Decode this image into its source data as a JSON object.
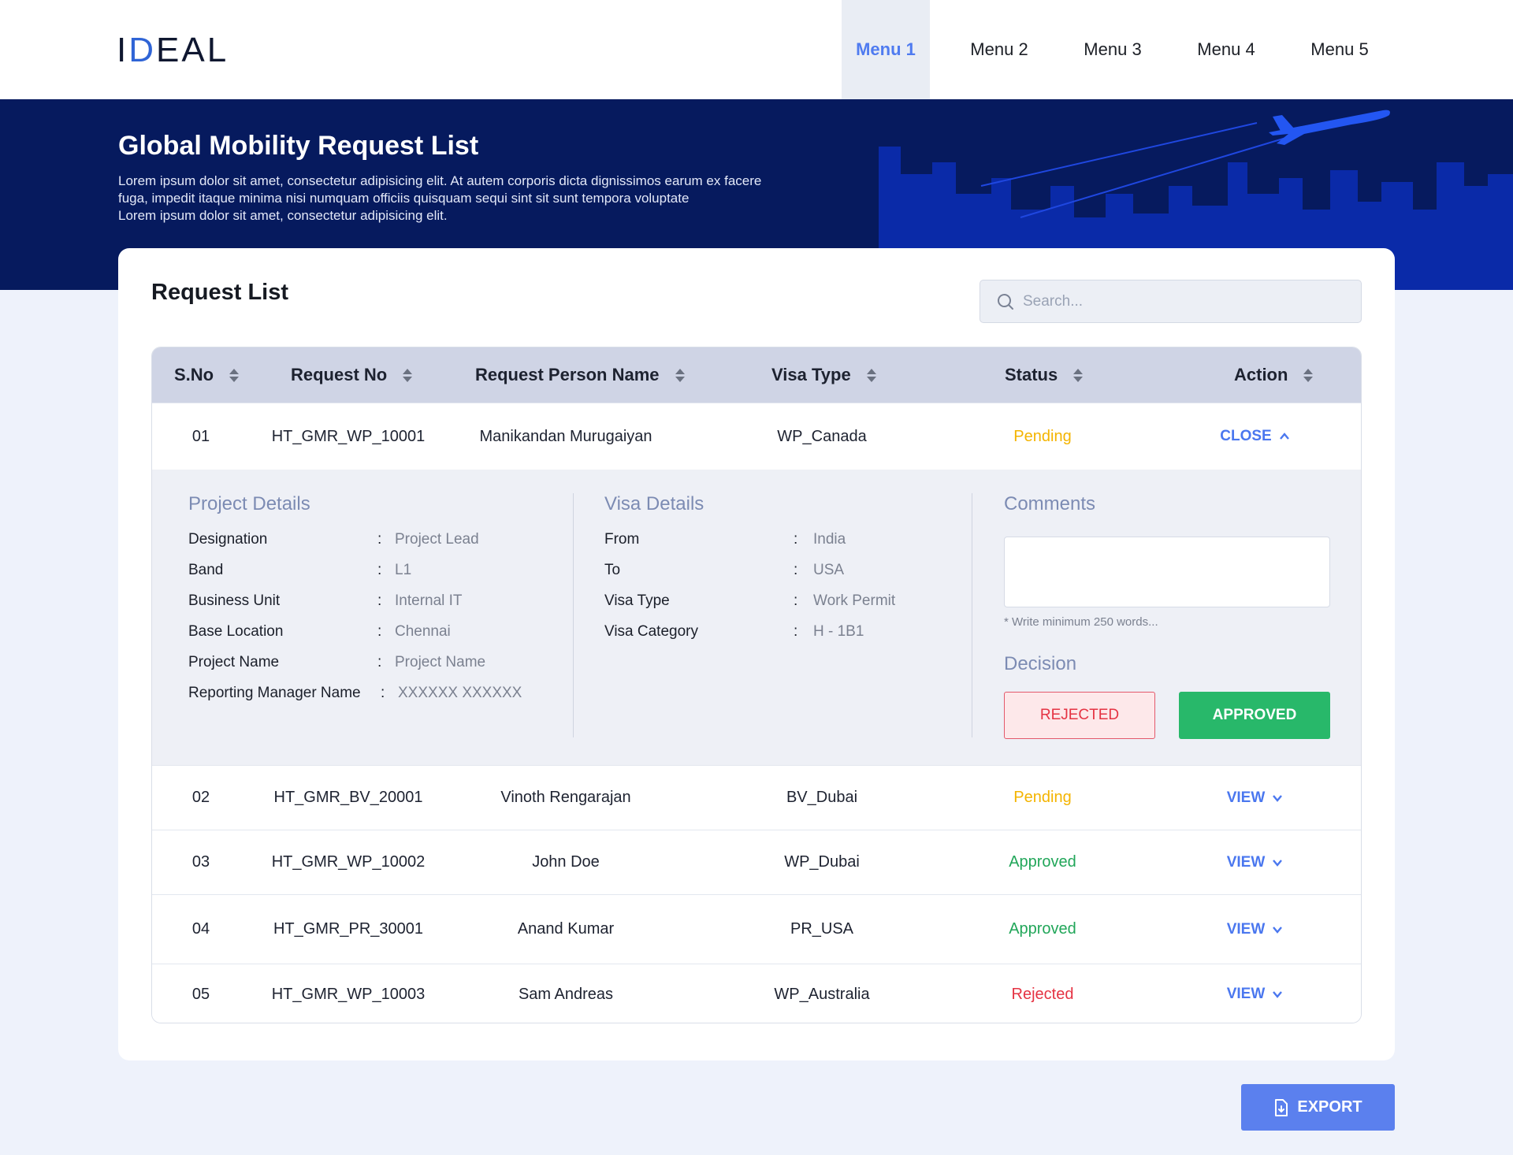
{
  "header": {
    "logo_text_1": "I",
    "logo_text_2": "D",
    "logo_text_3": "E",
    "logo_text_4": "A",
    "logo_text_5": "L",
    "nav": [
      {
        "label": "Menu 1"
      },
      {
        "label": "Menu 2"
      },
      {
        "label": "Menu 3"
      },
      {
        "label": "Menu 4"
      },
      {
        "label": "Menu 5"
      }
    ]
  },
  "banner": {
    "title": "Global Mobility Request List",
    "desc_1": "Lorem ipsum dolor sit amet, consectetur adipisicing elit. At autem corporis dicta dignissimos earum ex facere",
    "desc_2": "fuga, impedit itaque minima nisi numquam officiis quisquam sequi sint sit sunt tempora voluptate",
    "desc_3": "Lorem ipsum dolor sit amet, consectetur adipisicing elit."
  },
  "card": {
    "title": "Request List",
    "search_placeholder": "Search..."
  },
  "table": {
    "columns": [
      "S.No",
      "Request No",
      "Request Person Name",
      "Visa Type",
      "Status",
      "Action"
    ],
    "rows": [
      {
        "sno": "01",
        "request_no": "HT_GMR_WP_10001",
        "name": "Manikandan Murugaiyan",
        "visa_type": "WP_Canada",
        "status": "Pending",
        "action": "CLOSE"
      },
      {
        "sno": "02",
        "request_no": "HT_GMR_BV_20001",
        "name": "Vinoth Rengarajan",
        "visa_type": "BV_Dubai",
        "status": "Pending",
        "action": "VIEW"
      },
      {
        "sno": "03",
        "request_no": "HT_GMR_WP_10002",
        "name": "John Doe",
        "visa_type": "WP_Dubai",
        "status": "Approved",
        "action": "VIEW"
      },
      {
        "sno": "04",
        "request_no": "HT_GMR_PR_30001",
        "name": "Anand Kumar",
        "visa_type": "PR_USA",
        "status": "Approved",
        "action": "VIEW"
      },
      {
        "sno": "05",
        "request_no": "HT_GMR_WP_10003",
        "name": "Sam Andreas",
        "visa_type": "WP_Australia",
        "status": "Rejected",
        "action": "VIEW"
      }
    ]
  },
  "details": {
    "project": {
      "title": "Project Details",
      "items": [
        {
          "k": "Designation",
          "v": "Project Lead"
        },
        {
          "k": "Band",
          "v": "L1"
        },
        {
          "k": "Business Unit",
          "v": "Internal IT"
        },
        {
          "k": "Base Location",
          "v": "Chennai"
        },
        {
          "k": "Project Name",
          "v": "Project Name"
        },
        {
          "k": "Reporting Manager Name",
          "v": "XXXXXX XXXXXX"
        }
      ]
    },
    "visa": {
      "title": "Visa Details",
      "items": [
        {
          "k": "From",
          "v": "India"
        },
        {
          "k": "To",
          "v": "USA"
        },
        {
          "k": "Visa Type",
          "v": "Work Permit"
        },
        {
          "k": "Visa Category",
          "v": "H - 1B1"
        }
      ]
    },
    "comments": {
      "title": "Comments",
      "value": "",
      "hint": "* Write minimum 250 words..."
    },
    "decision": {
      "title": "Decision",
      "reject_label": "REJECTED",
      "approve_label": "APPROVED"
    },
    "colon": ":"
  },
  "export_label": "EXPORT",
  "colors": {
    "brand_dark": "#061a5e",
    "accent_blue": "#4a77ef",
    "pending": "#f4b400",
    "approved": "#21a659",
    "rejected": "#e53343"
  }
}
